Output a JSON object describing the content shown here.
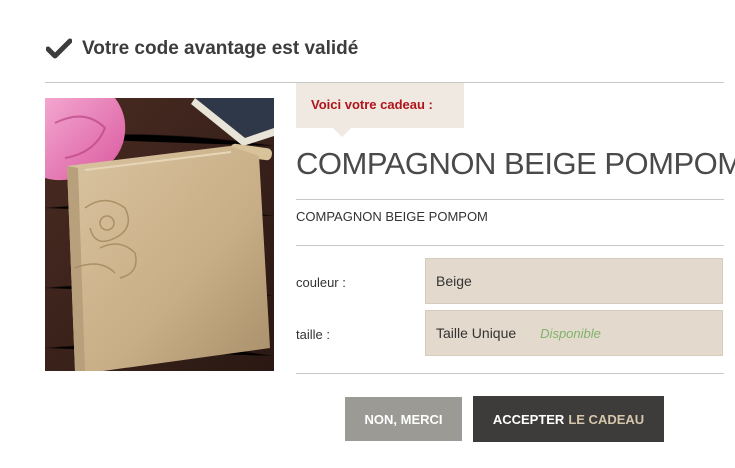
{
  "header": {
    "title": "Votre code avantage est validé",
    "icon": "check-icon"
  },
  "gift": {
    "tag_label": "Voici votre cadeau :"
  },
  "product": {
    "title": "COMPAGNON BEIGE POMPOM",
    "subtitle": "COMPAGNON BEIGE POMPOM",
    "image_icon": "product-photo-wallet"
  },
  "attributes": [
    {
      "label": "couleur :",
      "value": "Beige"
    },
    {
      "label": "taille :",
      "value": "Taille Unique",
      "availability": "Disponible"
    }
  ],
  "buttons": {
    "decline_label": "NON, MERCI",
    "accept_label_main": "ACCEPTER",
    "accept_label_accent": "LE CADEAU"
  },
  "colors": {
    "accent_red": "#b0131b",
    "tag_bg": "#efe9e1",
    "field_bg": "#e4d9cd",
    "available_green": "#7fb36b",
    "decline_bg": "#9b9a95",
    "accept_bg": "#3e3c3a"
  }
}
